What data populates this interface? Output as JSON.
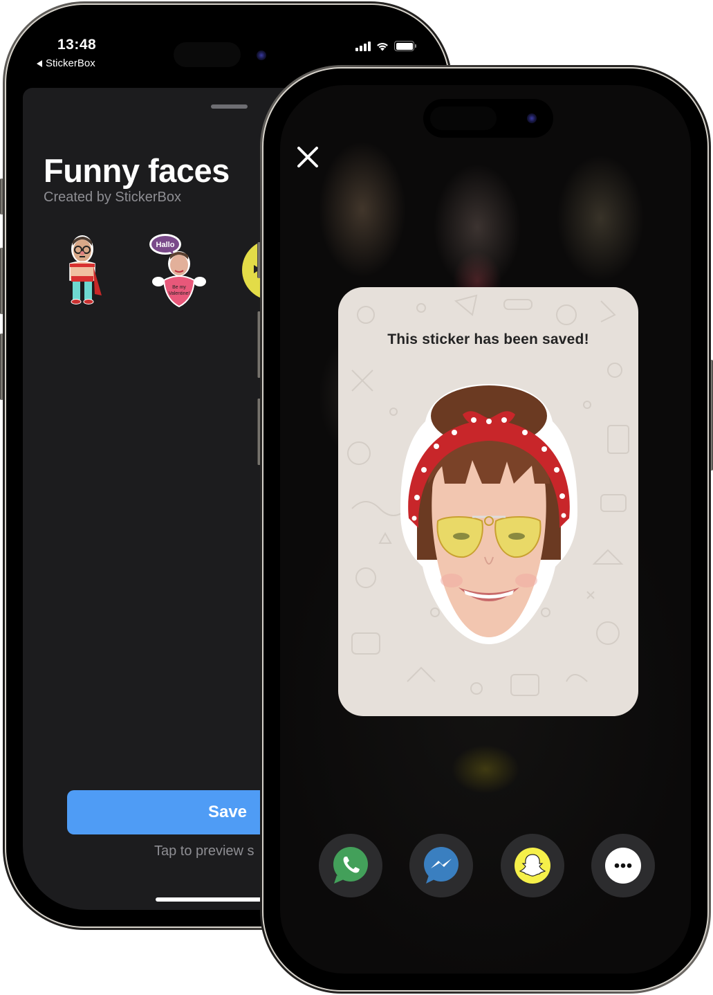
{
  "back_phone": {
    "status_bar": {
      "time": "13:48",
      "back_app_label": "StickerBox",
      "signal_bars": 4,
      "wifi": true,
      "battery_percent": 100
    },
    "sticker_pack": {
      "title": "Funny faces",
      "subtitle": "Created by StickerBox",
      "stickers": [
        {
          "name": "superhero-guy-with-glasses",
          "caption": ""
        },
        {
          "name": "valentine-guy",
          "bubble_text": "Hallo",
          "heart_text": "Be my Valentine!"
        },
        {
          "name": "yellow-sticker-partial",
          "caption": ""
        }
      ]
    },
    "save_button_label": "Save",
    "hint": "Tap to preview s"
  },
  "front_phone": {
    "dialog": {
      "title": "This sticker has been saved!",
      "sticker_name": "girl-red-polka-bandana-yellow-aviators"
    },
    "close_icon": "close-icon",
    "share_targets": [
      {
        "name": "WhatsApp",
        "icon": "whatsapp-icon",
        "color": "#43a05a"
      },
      {
        "name": "Messenger",
        "icon": "messenger-icon",
        "color": "#3a7fc0"
      },
      {
        "name": "Snapchat",
        "icon": "snapchat-icon",
        "color": "#f5f04a"
      },
      {
        "name": "More",
        "icon": "more-icon",
        "color": "#ffffff"
      }
    ]
  },
  "colors": {
    "save_button": "#4f9cf5",
    "sheet_bg": "#1c1c1e",
    "card_bg": "#e6e0da",
    "share_button_bg": "#2c2c2e"
  }
}
